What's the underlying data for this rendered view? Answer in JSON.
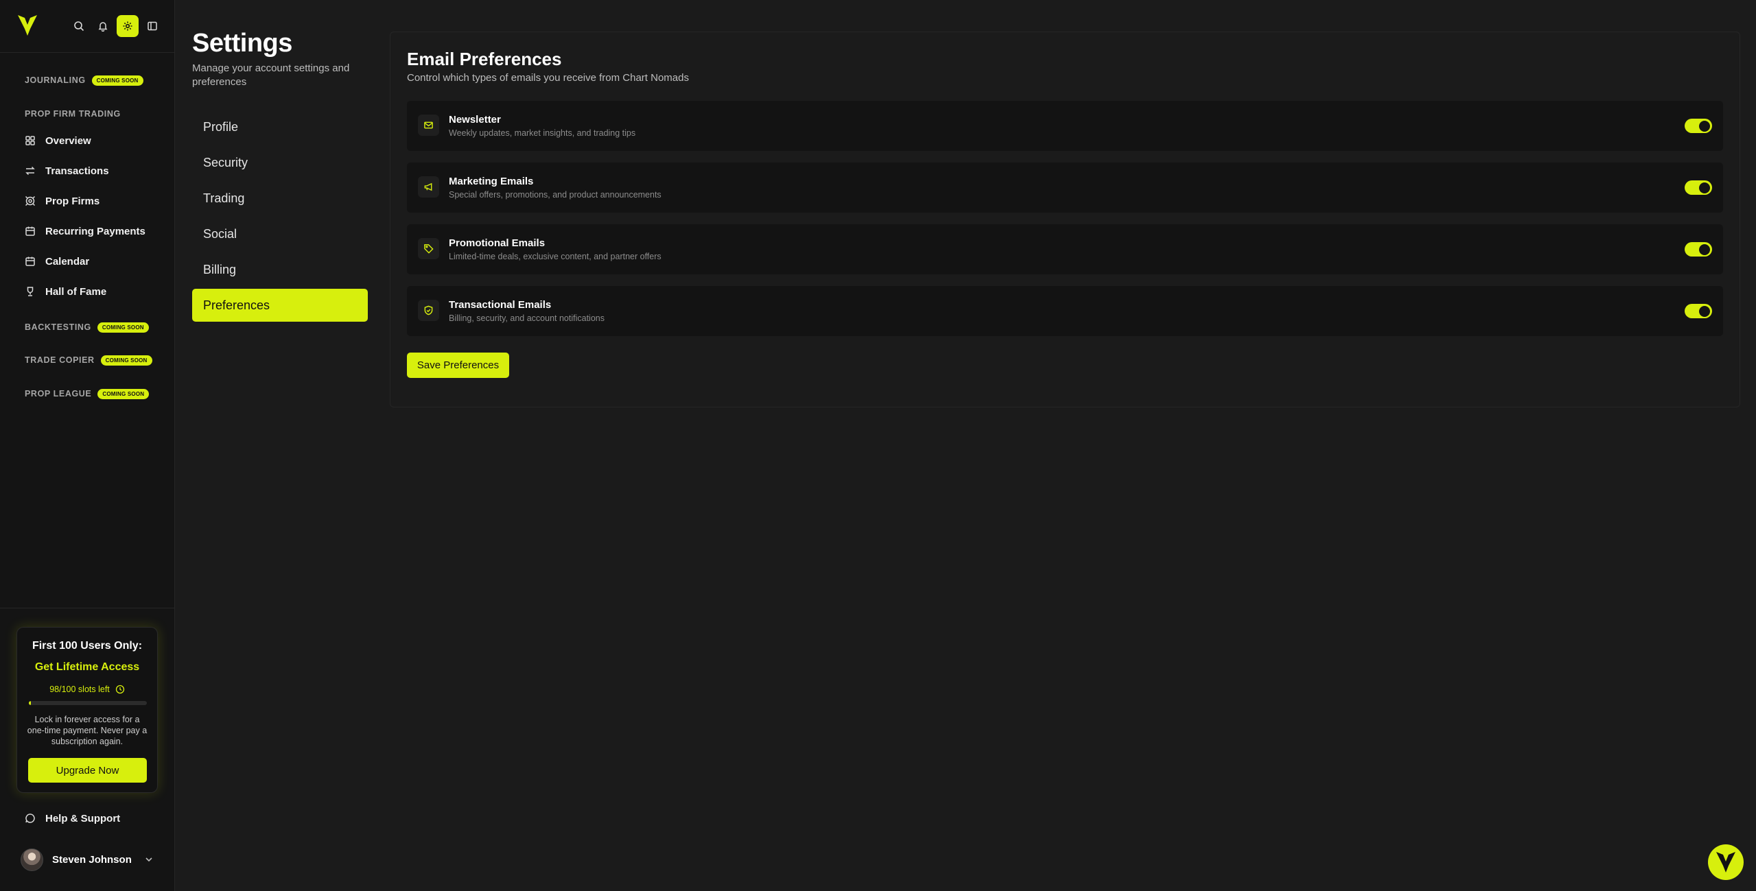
{
  "brand": {
    "accent": "#d7ef0d",
    "logo_icon": "chart-nomads-logo-icon"
  },
  "topbar": {
    "icons": [
      "search-icon",
      "bell-icon",
      "gear-icon",
      "sidebar-toggle-icon"
    ]
  },
  "sidebar": {
    "sections": {
      "journaling": {
        "label": "JOURNALING",
        "badge": "COMING SOON"
      },
      "prop_firm_trading": {
        "label": "PROP FIRM TRADING"
      },
      "backtesting": {
        "label": "BACKTESTING",
        "badge": "COMING SOON"
      },
      "trade_copier": {
        "label": "TRADE COPIER",
        "badge": "COMING SOON"
      },
      "prop_league": {
        "label": "PROP LEAGUE",
        "badge": "COMING SOON"
      }
    },
    "items": [
      {
        "label": "Overview",
        "icon": "grid-icon"
      },
      {
        "label": "Transactions",
        "icon": "arrows-swap-icon"
      },
      {
        "label": "Prop Firms",
        "icon": "target-icon"
      },
      {
        "label": "Recurring Payments",
        "icon": "calendar-icon"
      },
      {
        "label": "Calendar",
        "icon": "calendar-icon"
      },
      {
        "label": "Hall of Fame",
        "icon": "trophy-icon"
      }
    ],
    "promo": {
      "title": "First 100 Users Only:",
      "subtitle": "Get Lifetime Access",
      "slots": "98/100 slots left",
      "slots_progress_percent": 2,
      "description": "Lock in forever access for a one-time payment. Never pay a subscription again.",
      "button": "Upgrade Now"
    },
    "help": {
      "label": "Help & Support",
      "icon": "chat-bubble-icon"
    },
    "user": {
      "name": "Steven Johnson"
    }
  },
  "settings": {
    "title": "Settings",
    "subtitle": "Manage your account settings and preferences",
    "nav": [
      {
        "label": "Profile"
      },
      {
        "label": "Security"
      },
      {
        "label": "Trading"
      },
      {
        "label": "Social"
      },
      {
        "label": "Billing"
      },
      {
        "label": "Preferences",
        "active": true
      }
    ]
  },
  "email_preferences": {
    "title": "Email Preferences",
    "subtitle": "Control which types of emails you receive from Chart Nomads",
    "items": [
      {
        "name": "Newsletter",
        "description": "Weekly updates, market insights, and trading tips",
        "icon": "mail-icon",
        "enabled": true
      },
      {
        "name": "Marketing Emails",
        "description": "Special offers, promotions, and product announcements",
        "icon": "megaphone-icon",
        "enabled": true
      },
      {
        "name": "Promotional Emails",
        "description": "Limited-time deals, exclusive content, and partner offers",
        "icon": "tag-icon",
        "enabled": true
      },
      {
        "name": "Transactional Emails",
        "description": "Billing, security, and account notifications",
        "icon": "shield-check-icon",
        "enabled": true
      }
    ],
    "save_button": "Save Preferences"
  }
}
